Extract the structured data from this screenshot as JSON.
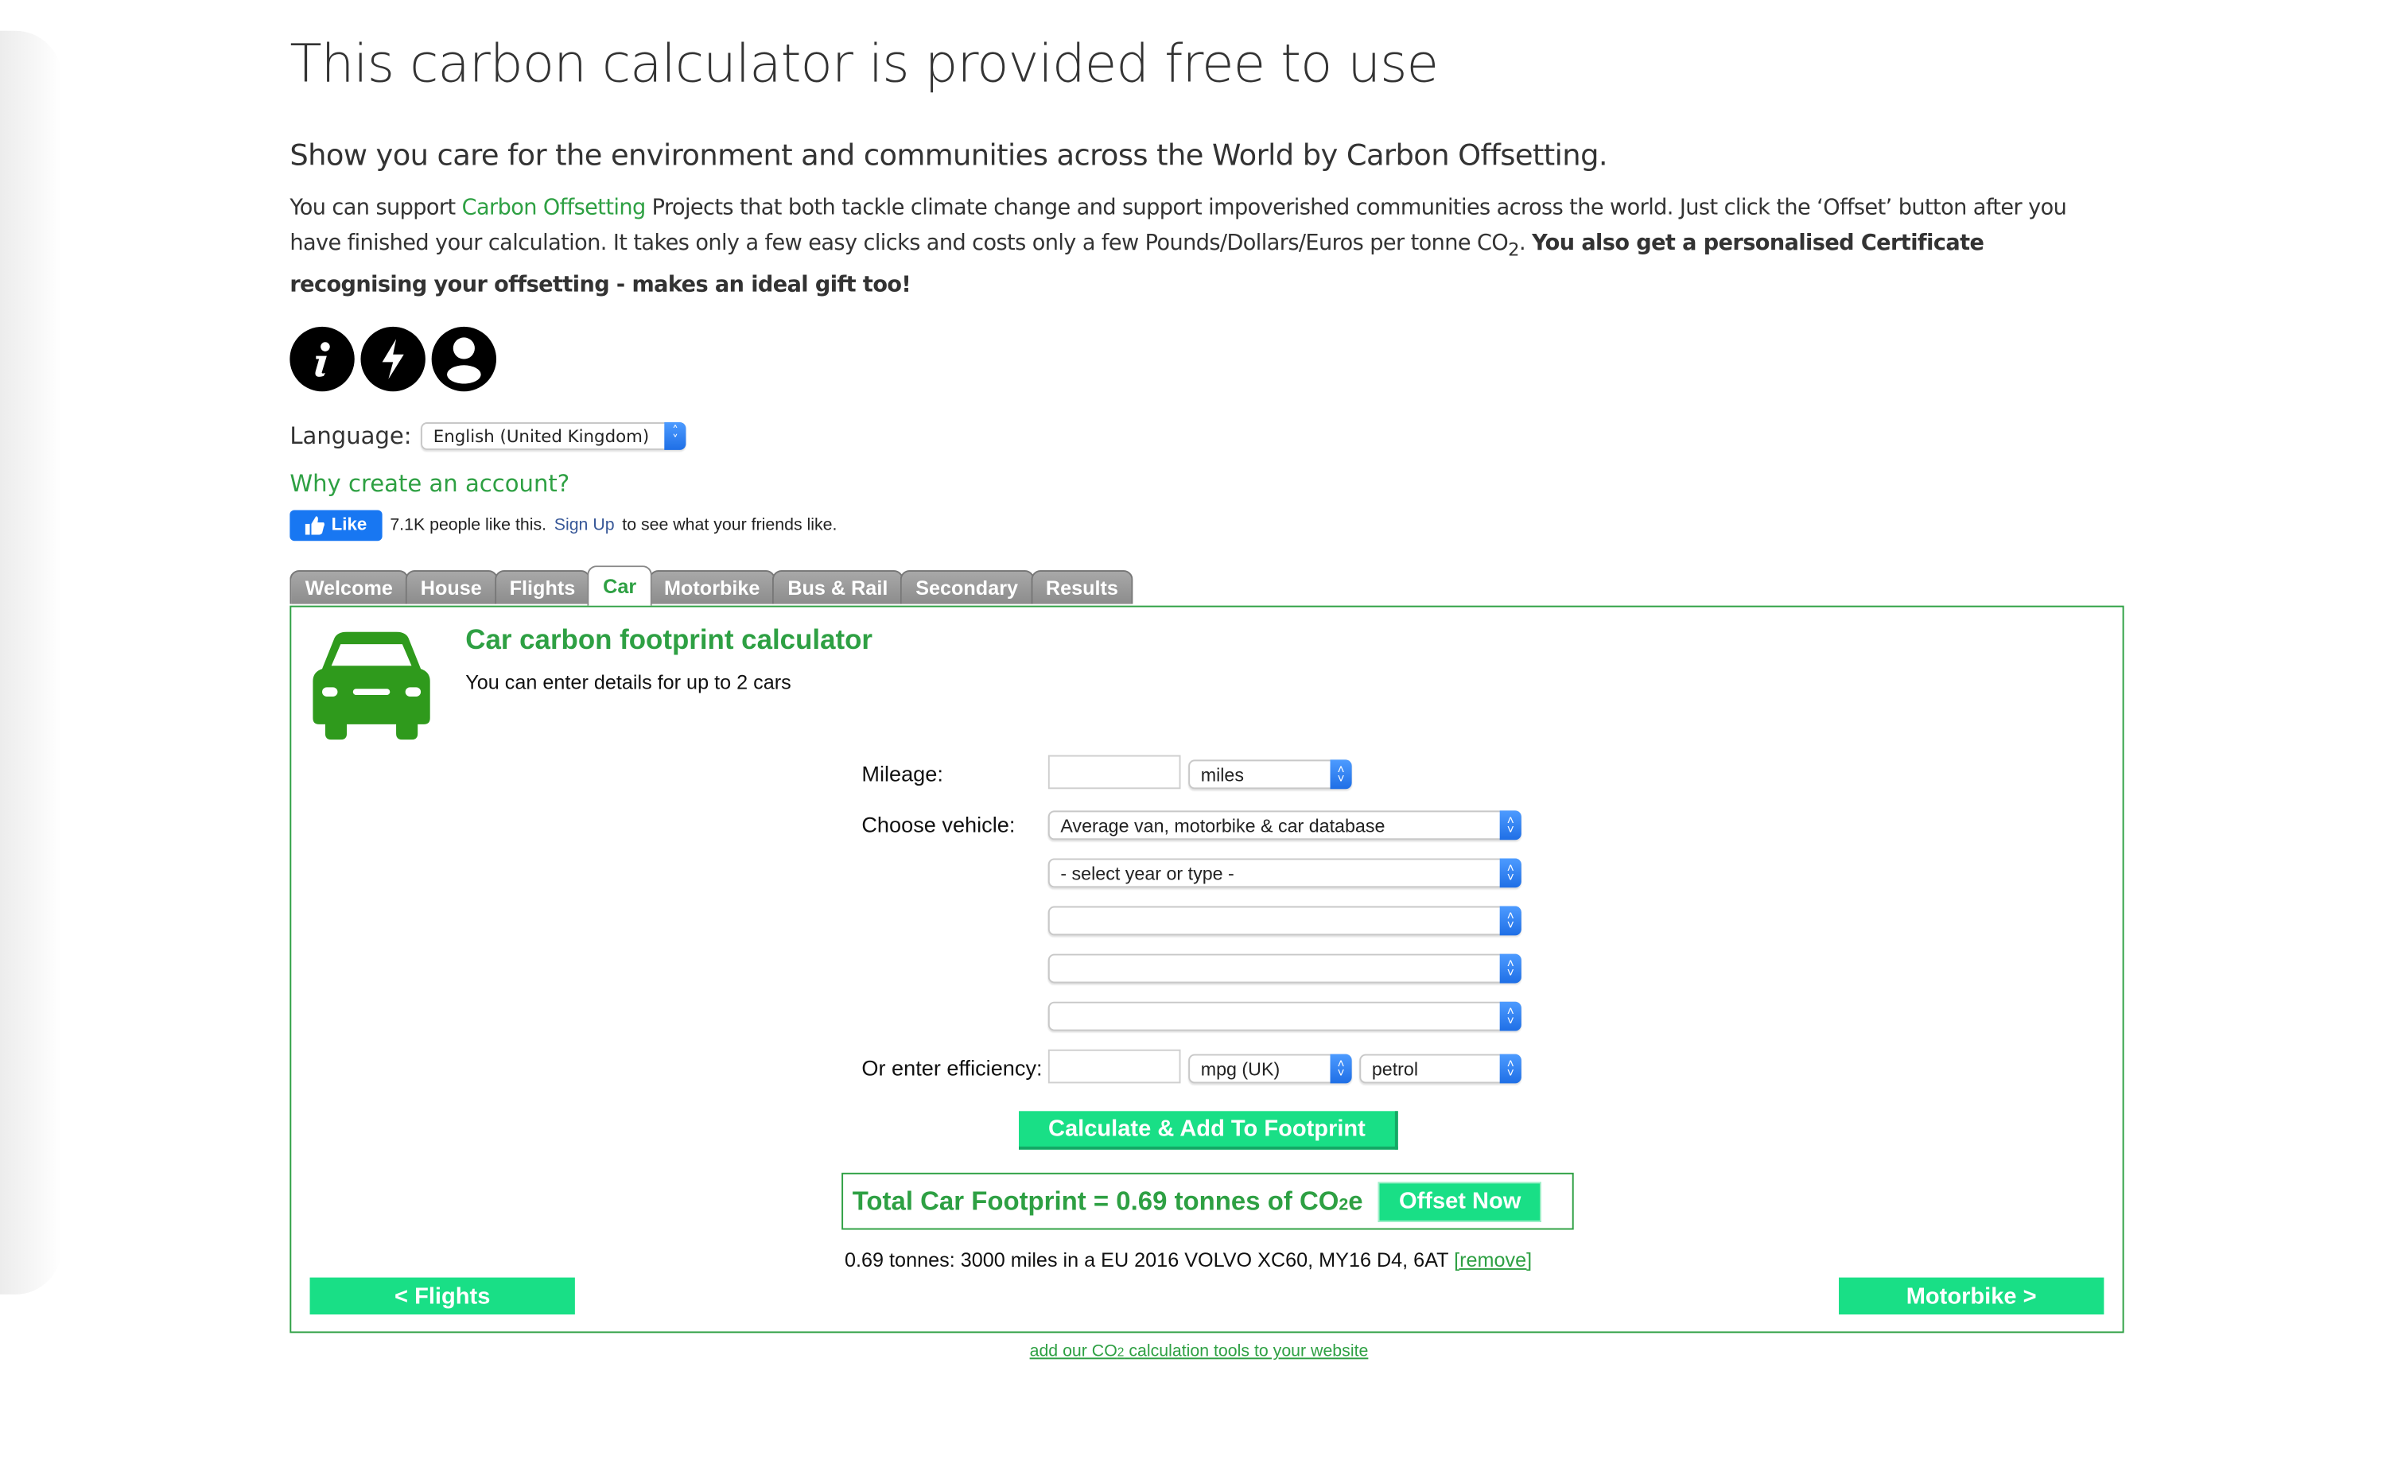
{
  "heading": "This carbon calculator is provided free to use",
  "subheading": "Show you care for the environment and communities across the World by Carbon Offsetting.",
  "intro": {
    "part1": "You can support ",
    "link": "Carbon Offsetting",
    "part2": " Projects that both tackle climate change and support impoverished communities across the world. Just click the ‘Offset’ button after you have finished your calculation. It takes only a few easy clicks and costs only a few Pounds/Dollars/Euros per tonne CO",
    "sub": "2",
    "part3": ". ",
    "bold": "You also get a personalised Certificate recognising your offsetting - makes an ideal gift too!"
  },
  "icons": [
    "info-icon",
    "lightning-icon",
    "user-icon"
  ],
  "language": {
    "label": "Language:",
    "selected": "English (United Kingdom)"
  },
  "why_account": "Why create an account?",
  "facebook": {
    "like": "Like",
    "count_text": "7.1K people like this.",
    "signup": "Sign Up",
    "rest": "to see what your friends like."
  },
  "tabs": [
    "Welcome",
    "House",
    "Flights",
    "Car",
    "Motorbike",
    "Bus & Rail",
    "Secondary",
    "Results"
  ],
  "active_tab": "Car",
  "panel": {
    "title": "Car carbon footprint calculator",
    "subtitle": "You can enter details for up to 2 cars",
    "mileage_label": "Mileage:",
    "mileage_value": "",
    "mileage_unit": "miles",
    "vehicle_label": "Choose vehicle:",
    "vehicle_db": "Average van, motorbike & car database",
    "year_type": "- select year or type -",
    "select3": "",
    "select4": "",
    "select5": "",
    "efficiency_label": "Or enter efficiency:",
    "efficiency_value": "",
    "efficiency_unit": "mpg (UK)",
    "fuel": "petrol",
    "calc_button": "Calculate & Add To Footprint",
    "total_text": "Total Car Footprint = 0.69 tonnes of CO",
    "total_sub": "2",
    "total_suffix": "e",
    "offset_button": "Offset Now",
    "summary": "0.69 tonnes: 3000 miles in a EU 2016 VOLVO XC60, MY16 D4, 6AT",
    "remove": "[remove]",
    "prev_button": "< Flights",
    "next_button": "Motorbike >"
  },
  "footer_link": {
    "pre": "add our CO",
    "sub": "2",
    "post": " calculation tools to your website"
  },
  "colors": {
    "green": "#2ea043",
    "button_green": "#19df86",
    "fb_blue": "#1877f2"
  }
}
